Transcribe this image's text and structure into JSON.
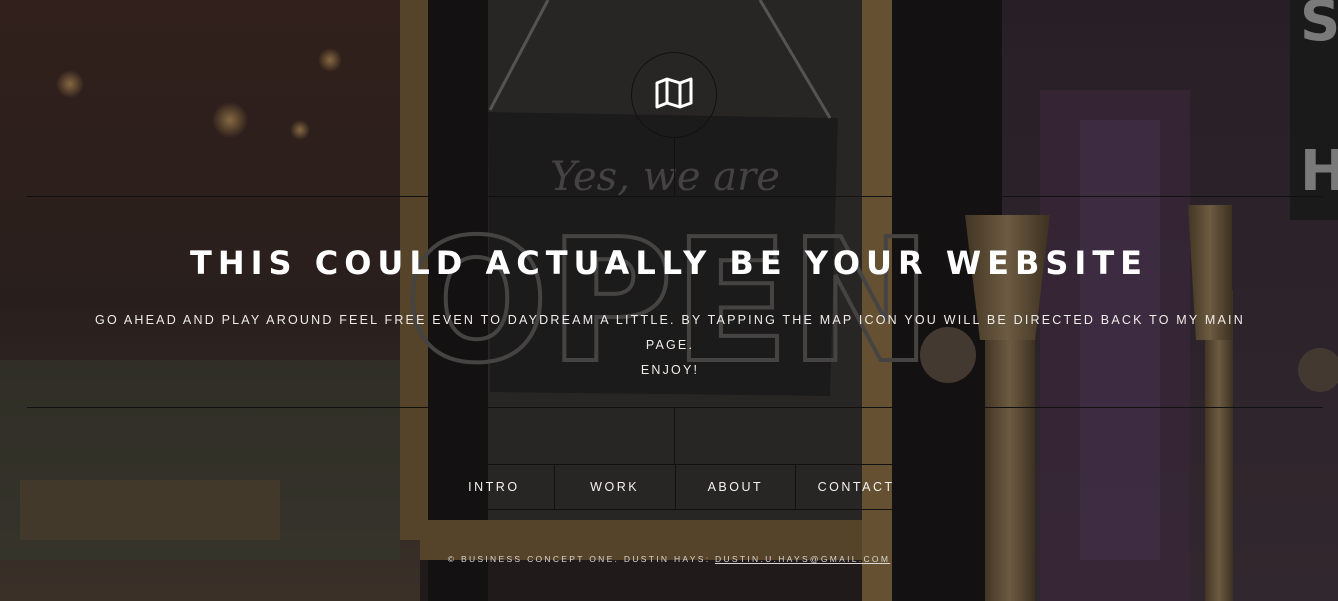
{
  "logo": {
    "icon": "map-icon"
  },
  "hero": {
    "title": "THIS COULD ACTUALLY BE YOUR WEBSITE",
    "subtitle_line1": "GO AHEAD AND PLAY AROUND FEEL FREE EVEN TO DAYDREAM A LITTLE. BY TAPPING THE MAP ICON YOU WILL BE DIRECTED BACK TO MY MAIN PAGE.",
    "subtitle_line2": "ENJOY!"
  },
  "nav": {
    "items": [
      {
        "label": "INTRO"
      },
      {
        "label": "WORK"
      },
      {
        "label": "ABOUT"
      },
      {
        "label": "CONTACT"
      }
    ]
  },
  "footer": {
    "text": "© BUSINESS CONCEPT ONE. DUSTIN HAYS: ",
    "email": "DUSTIN.U.HAYS@GMAIL.COM"
  },
  "colors": {
    "text": "#ffffff",
    "lines": "#111111",
    "overlay": "#141214"
  }
}
